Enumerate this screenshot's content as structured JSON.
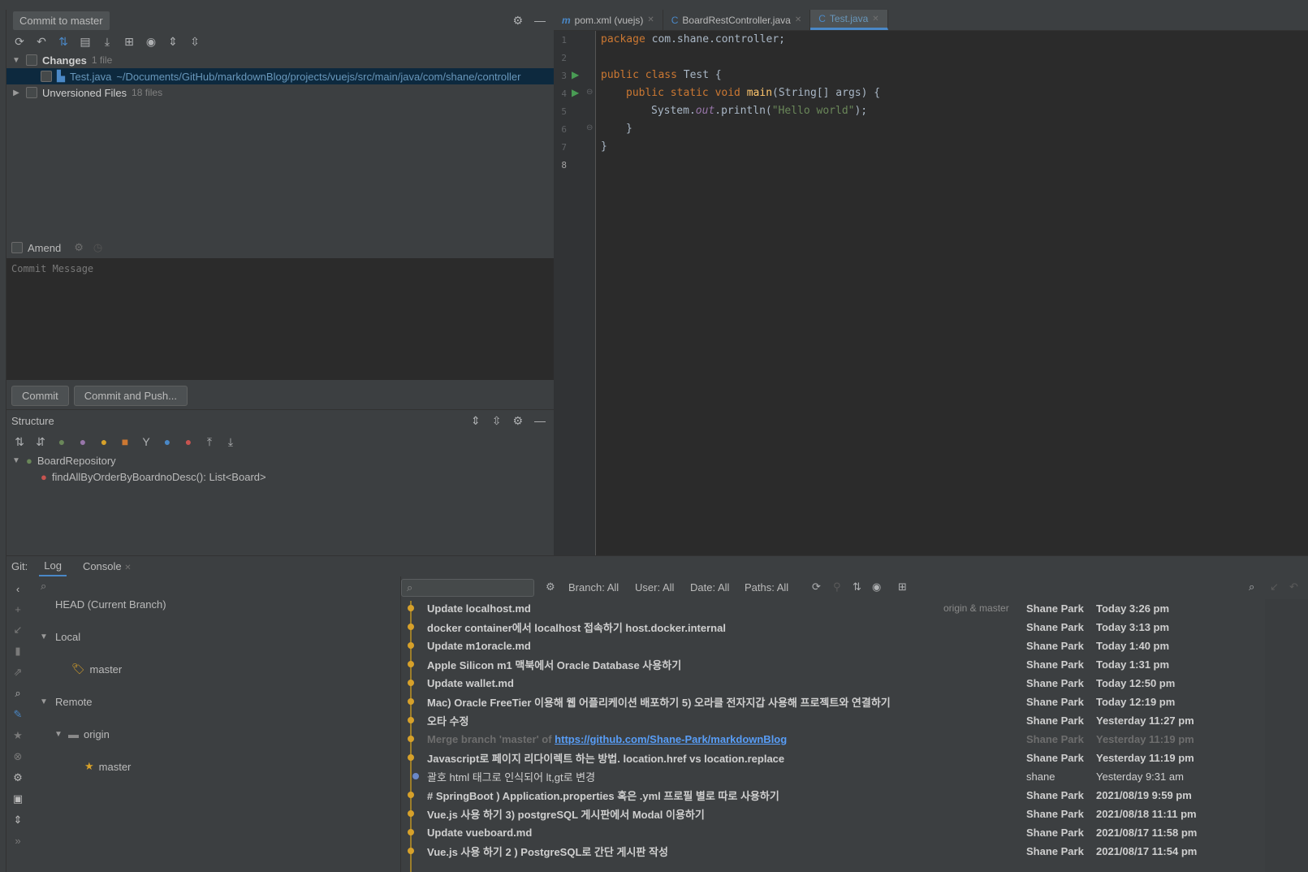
{
  "commit": {
    "title": "Commit to master",
    "changes_label": "Changes",
    "changes_count": "1 file",
    "file_name": "Test.java",
    "file_path": "~/Documents/GitHub/markdownBlog/projects/vuejs/src/main/java/com/shane/controller",
    "unversioned_label": "Unversioned Files",
    "unversioned_count": "18 files",
    "amend_label": "Amend",
    "message_placeholder": "Commit Message",
    "commit_button": "Commit",
    "commit_push_button": "Commit and Push..."
  },
  "structure": {
    "title": "Structure",
    "class_name": "BoardRepository",
    "method": "findAllByOrderByBoardnoDesc(): List<Board>"
  },
  "editor": {
    "tabs": [
      {
        "label": "pom.xml (vuejs)",
        "icon": "m"
      },
      {
        "label": "BoardRestController.java",
        "icon": "C"
      },
      {
        "label": "Test.java",
        "icon": "C"
      }
    ],
    "line_numbers": [
      "1",
      "2",
      "3",
      "4",
      "5",
      "6",
      "7",
      "8"
    ],
    "code": {
      "l1_kw": "package",
      "l1_rest": " com.shane.controller;",
      "l3_kw": "public class",
      "l3_rest": " Test {",
      "l4_kw": "public static void",
      "l4_fn": "main",
      "l4_rest": "(String[] args) {",
      "l5_a": "System.",
      "l5_out": "out",
      "l5_b": ".println(",
      "l5_str": "\"Hello world\"",
      "l5_c": ");",
      "l6": "}",
      "l7": "}"
    }
  },
  "git": {
    "label": "Git:",
    "log_tab": "Log",
    "console_tab": "Console",
    "branches": {
      "head": "HEAD (Current Branch)",
      "local": "Local",
      "local_master": "master",
      "remote": "Remote",
      "origin": "origin",
      "origin_master": "master"
    },
    "filters": {
      "branch": "Branch: All",
      "user": "User: All",
      "date": "Date: All",
      "paths": "Paths: All"
    },
    "tag_label": "origin & master",
    "commits": [
      {
        "msg": "Update localhost.md",
        "author": "Shane Park",
        "date": "Today 3:26 pm"
      },
      {
        "msg": "docker container에서 localhost 접속하기 host.docker.internal",
        "author": "Shane Park",
        "date": "Today 3:13 pm"
      },
      {
        "msg": "Update m1oracle.md",
        "author": "Shane Park",
        "date": "Today 1:40 pm"
      },
      {
        "msg": "Apple Silicon m1 맥북에서 Oracle Database 사용하기",
        "author": "Shane Park",
        "date": "Today 1:31 pm"
      },
      {
        "msg": "Update wallet.md",
        "author": "Shane Park",
        "date": "Today 12:50 pm"
      },
      {
        "msg": "Mac) Oracle FreeTier 이용해 웹 어플리케이션 배포하기 5) 오라클 전자지갑 사용해 프로젝트와 연결하기",
        "author": "Shane Park",
        "date": "Today 12:19 pm"
      },
      {
        "msg": "오타 수정",
        "author": "Shane Park",
        "date": "Yesterday 11:27 pm"
      },
      {
        "msg": "Merge branch 'master' of ",
        "link": "https://github.com/Shane-Park/markdownBlog",
        "author": "Shane Park",
        "date": "Yesterday 11:19 pm"
      },
      {
        "msg": "Javascript로 페이지 리다이렉트 하는 방법. location.href vs location.replace",
        "author": "Shane Park",
        "date": "Yesterday 11:19 pm"
      },
      {
        "msg": "괄호 html 태그로 인식되어 lt,gt로 변경",
        "author": "shane",
        "date": "Yesterday 9:31 am"
      },
      {
        "msg": "# SpringBoot ) Application.properties 혹은 .yml 프로필 별로 따로 사용하기",
        "author": "Shane Park",
        "date": "2021/08/19 9:59 pm"
      },
      {
        "msg": "Vue.js 사용 하기 3) postgreSQL 게시판에서 Modal 이용하기",
        "author": "Shane Park",
        "date": "2021/08/18 11:11 pm"
      },
      {
        "msg": "Update vueboard.md",
        "author": "Shane Park",
        "date": "2021/08/17 11:58 pm"
      },
      {
        "msg": "Vue.js 사용 하기 2 ) PostgreSQL로 간단 게시판 작성",
        "author": "Shane Park",
        "date": "2021/08/17 11:54 pm"
      }
    ]
  },
  "colors": {
    "accent": "#4a88c7",
    "background": "#2b2b2b",
    "panel": "#3c3f41",
    "commit_dot": "#d7a12a"
  }
}
